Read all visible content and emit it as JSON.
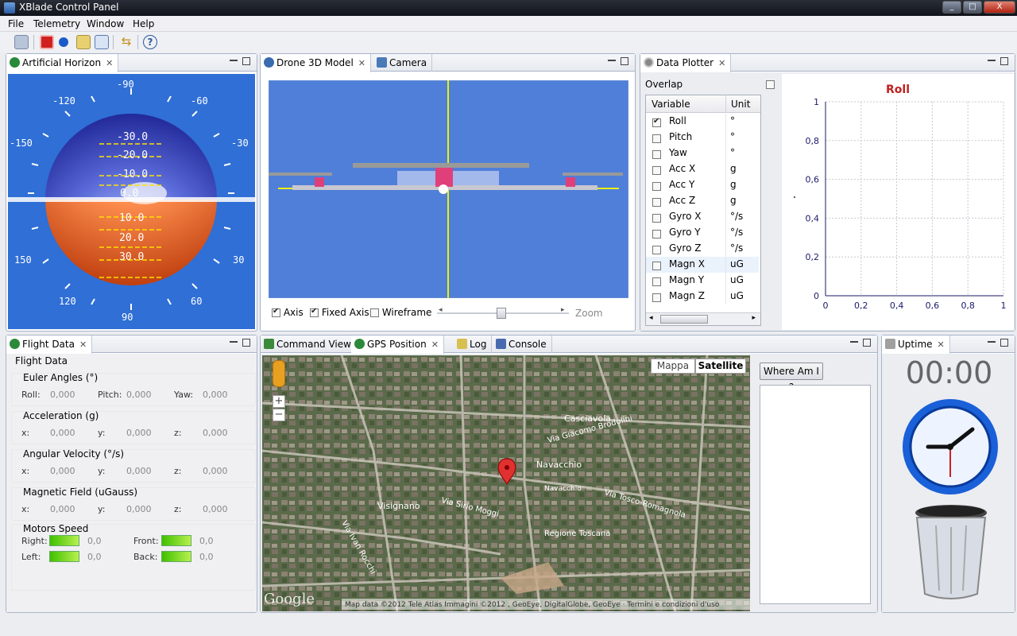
{
  "window": {
    "title": "XBlade Control Panel",
    "controls": [
      "_",
      "□",
      "X"
    ]
  },
  "menu": [
    "File",
    "Telemetry",
    "Window",
    "Help"
  ],
  "toolbar": {
    "icons": [
      "save-icon",
      "stop-icon",
      "record-icon",
      "connect-icon",
      "table-icon",
      "swap-icon",
      "help-icon"
    ]
  },
  "horizon": {
    "tab": "Artificial Horizon",
    "roll_scale": [
      "-90",
      "-120",
      "-60",
      "-150",
      "-30",
      "150",
      "30",
      "120",
      "60",
      "90"
    ],
    "pitch_lines": [
      "-30.0",
      "-20.0",
      "-10.0",
      "0.0",
      "10.0",
      "20.0",
      "30.0"
    ]
  },
  "model3d": {
    "tabs": [
      "Drone 3D Model",
      "Camera"
    ],
    "checkboxes": [
      {
        "label": "Axis",
        "checked": true
      },
      {
        "label": "Fixed Axis",
        "checked": true
      },
      {
        "label": "Wireframe",
        "checked": false
      }
    ],
    "zoom_label": "Zoom"
  },
  "plotter": {
    "tab": "Data Plotter",
    "overlap_label": "Overlap",
    "columns": [
      "Variable",
      "Unit"
    ],
    "rows": [
      {
        "name": "Roll",
        "unit": "°",
        "checked": true
      },
      {
        "name": "Pitch",
        "unit": "°",
        "checked": false
      },
      {
        "name": "Yaw",
        "unit": "°",
        "checked": false
      },
      {
        "name": "Acc X",
        "unit": "g",
        "checked": false
      },
      {
        "name": "Acc Y",
        "unit": "g",
        "checked": false
      },
      {
        "name": "Acc Z",
        "unit": "g",
        "checked": false
      },
      {
        "name": "Gyro X",
        "unit": "°/s",
        "checked": false
      },
      {
        "name": "Gyro Y",
        "unit": "°/s",
        "checked": false
      },
      {
        "name": "Gyro Z",
        "unit": "°/s",
        "checked": false
      },
      {
        "name": "Magn X",
        "unit": "uG",
        "checked": false
      },
      {
        "name": "Magn Y",
        "unit": "uG",
        "checked": false
      },
      {
        "name": "Magn Z",
        "unit": "uG",
        "checked": false
      }
    ],
    "chart_data": {
      "type": "line",
      "title": "Roll",
      "xlabel": "",
      "ylabel": "",
      "x_ticks": [
        "0",
        "0,2",
        "0,4",
        "0,6",
        "0,8",
        "1"
      ],
      "y_ticks": [
        "0",
        "0,2",
        "0,4",
        "0,6",
        "0,8",
        "1"
      ],
      "xlim": [
        0,
        1
      ],
      "ylim": [
        0,
        1
      ],
      "grid": true,
      "series": [
        {
          "values": []
        }
      ]
    }
  },
  "flight": {
    "tab": "Flight Data",
    "heading": "Flight Data",
    "groups": [
      {
        "title": "Euler Angles (°)",
        "fields": [
          {
            "label": "Roll:",
            "value": "0,000"
          },
          {
            "label": "Pitch:",
            "value": "0,000"
          },
          {
            "label": "Yaw:",
            "value": "0,000"
          }
        ]
      },
      {
        "title": "Acceleration (g)",
        "fields": [
          {
            "label": "x:",
            "value": "0,000"
          },
          {
            "label": "y:",
            "value": "0,000"
          },
          {
            "label": "z:",
            "value": "0,000"
          }
        ]
      },
      {
        "title": "Angular Velocity (°/s)",
        "fields": [
          {
            "label": "x:",
            "value": "0,000"
          },
          {
            "label": "y:",
            "value": "0,000"
          },
          {
            "label": "z:",
            "value": "0,000"
          }
        ]
      },
      {
        "title": "Magnetic Field (uGauss)",
        "fields": [
          {
            "label": "x:",
            "value": "0,000"
          },
          {
            "label": "y:",
            "value": "0,000"
          },
          {
            "label": "z:",
            "value": "0,000"
          }
        ]
      }
    ],
    "motors": {
      "title": "Motors Speed",
      "items": [
        {
          "label": "Right:",
          "value": "0,0"
        },
        {
          "label": "Front:",
          "value": "0,0"
        },
        {
          "label": "Left:",
          "value": "0,0"
        },
        {
          "label": "Back:",
          "value": "0,0"
        }
      ]
    }
  },
  "gps": {
    "tabs": [
      "Command View",
      "GPS Position",
      "Log",
      "Console"
    ],
    "map_types": [
      "Mappa",
      "Satellite"
    ],
    "zoom_in": "+",
    "zoom_out": "−",
    "labels": [
      "Casciavola",
      "Navacchio",
      "Navacchio",
      "Visignano",
      "Regione Toscana",
      "Via Tosco-Romagnola",
      "Via Sirio Moggi",
      "Via Ivan Rocchi",
      "Via Giacomo Brodolini"
    ],
    "google": "Google",
    "attribution": "Map data ©2012 Tele Atlas Immagini ©2012 , GeoEye, DigitalGlobe, GeoEye · Termini e condizioni d'uso",
    "where_button": "Where Am I ?"
  },
  "uptime": {
    "tab": "Uptime",
    "time": "00:00"
  }
}
